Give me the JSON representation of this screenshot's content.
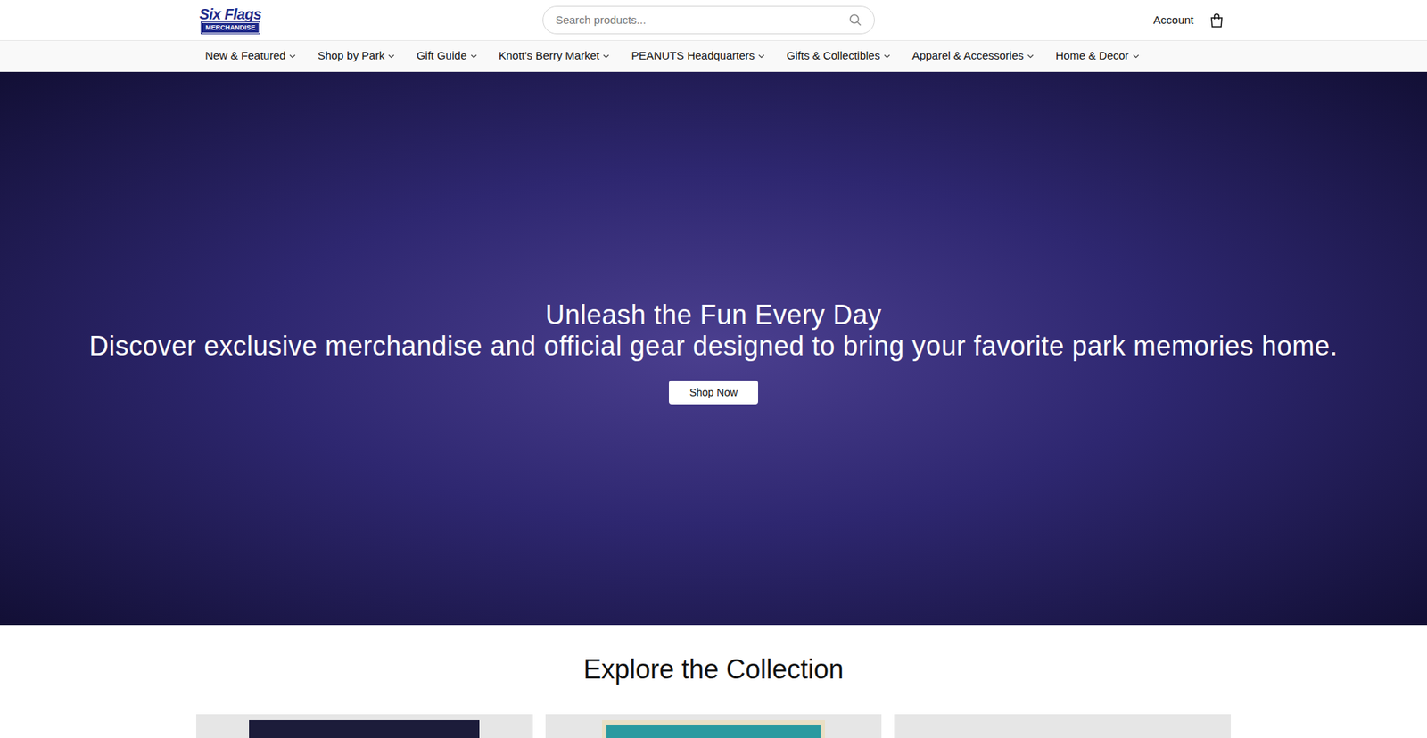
{
  "header": {
    "logo": {
      "top": "Six Flags",
      "bottom": "MERCHANDISE"
    },
    "search": {
      "placeholder": "Search products..."
    },
    "account": "Account"
  },
  "nav": {
    "items": [
      "New & Featured",
      "Shop by Park",
      "Gift Guide",
      "Knott's Berry Market",
      "PEANUTS Headquarters",
      "Gifts & Collectibles",
      "Apparel & Accessories",
      "Home & Decor"
    ]
  },
  "hero": {
    "title": "Unleash the Fun Every Day",
    "subtitle": "Discover exclusive merchandise and official gear designed to bring your favorite park memories home.",
    "button": "Shop Now"
  },
  "collection": {
    "title": "Explore the Collection",
    "cards": [
      {},
      {},
      {}
    ]
  }
}
